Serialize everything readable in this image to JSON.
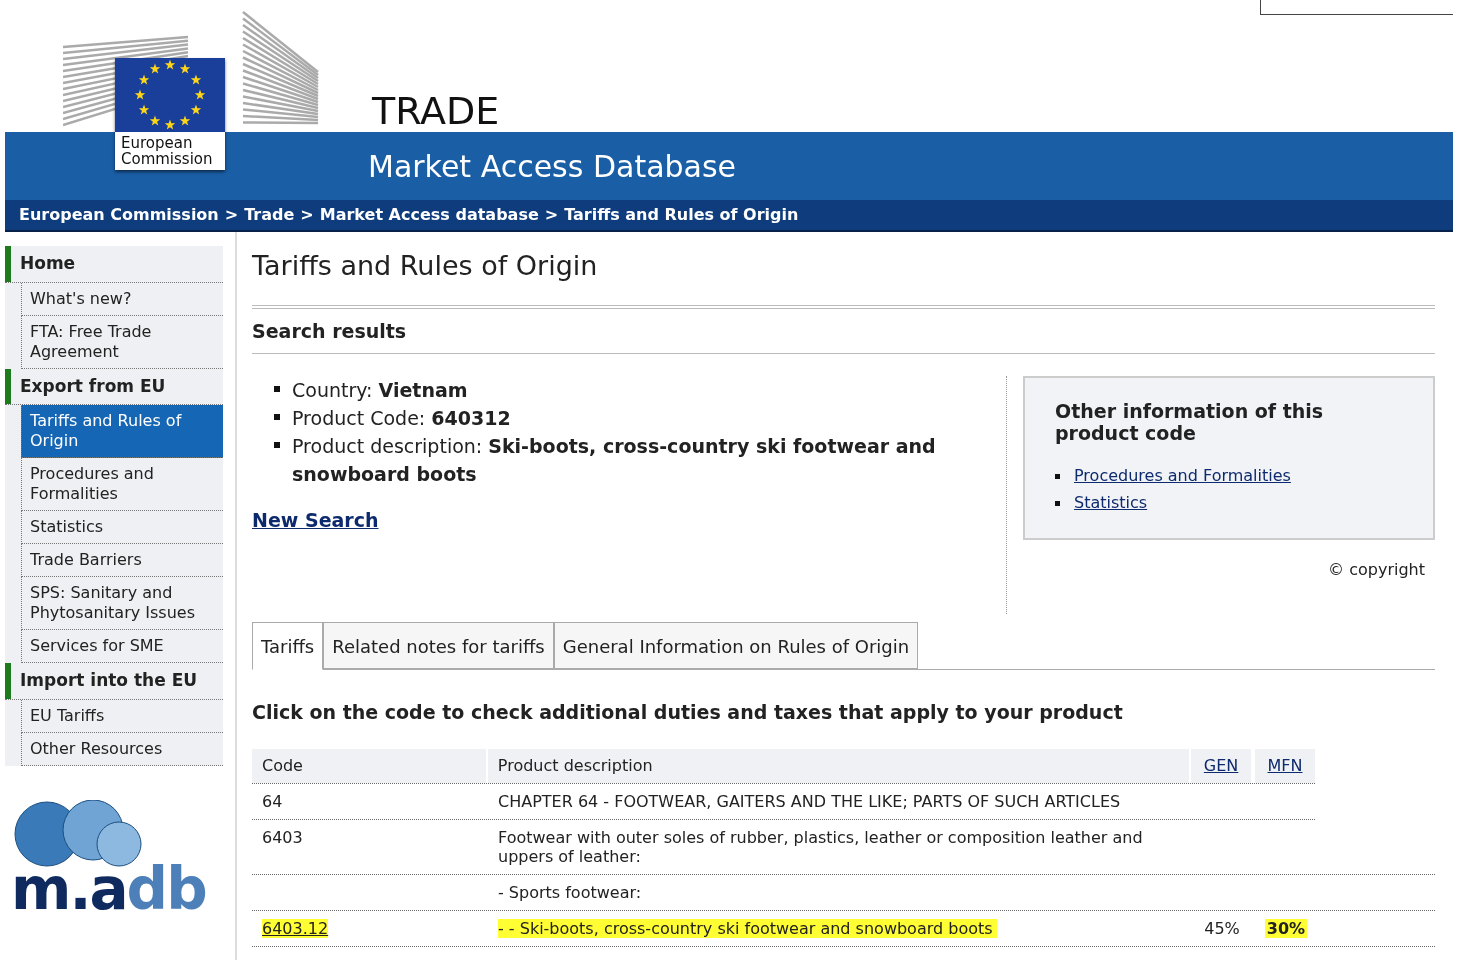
{
  "header": {
    "logo_caption": "European Commission",
    "madb_logo": [
      "m.a",
      "db"
    ],
    "site_section": "TRADE",
    "site_title": "Market Access Database"
  },
  "breadcrumb": [
    "European Commission",
    "Trade",
    "Market Access database",
    "Tariffs and Rules of Origin"
  ],
  "breadcrumb_separator": ">",
  "sidebar": {
    "sections": [
      {
        "label": "Home",
        "children": [
          {
            "label": "What's new?",
            "selected": false
          },
          {
            "label": "FTA: Free Trade Agreement",
            "selected": false
          }
        ]
      },
      {
        "label": "Export from EU",
        "children": [
          {
            "label": "Tariffs and Rules of Origin",
            "selected": true
          },
          {
            "label": "Procedures and Formalities",
            "selected": false
          },
          {
            "label": "Statistics",
            "selected": false
          },
          {
            "label": "Trade Barriers",
            "selected": false
          },
          {
            "label": "SPS: Sanitary and Phytosanitary Issues",
            "selected": false
          },
          {
            "label": "Services for SME",
            "selected": false
          }
        ]
      },
      {
        "label": "Import into the EU",
        "children": [
          {
            "label": "EU Tariffs",
            "selected": false
          },
          {
            "label": "Other Resources",
            "selected": false
          }
        ]
      }
    ]
  },
  "page_title": "Tariffs and Rules of Origin",
  "search_results": {
    "heading": "Search results",
    "criteria": [
      {
        "label": "Country:",
        "value": "Vietnam"
      },
      {
        "label": "Product Code:",
        "value": "640312"
      },
      {
        "label": "Product description:",
        "value": "Ski-boots, cross-country ski footwear and snowboard boots"
      }
    ],
    "new_search": "New Search"
  },
  "other_info": {
    "heading": "Other information of this product code",
    "links": [
      "Procedures and Formalities",
      "Statistics"
    ]
  },
  "copyright": "© copyright",
  "tabs": [
    {
      "label": "Tariffs",
      "selected": true
    },
    {
      "label": "Related notes for tariffs",
      "selected": false
    },
    {
      "label": "General Information on Rules of Origin",
      "selected": false
    }
  ],
  "instruction": "Click on the code to check additional duties and taxes that apply to your product",
  "table": {
    "columns": [
      "Code",
      "Product description",
      "GEN",
      "MFN"
    ],
    "rows": [
      {
        "code": "64",
        "description": "CHAPTER 64 - FOOTWEAR, GAITERS AND THE LIKE; PARTS OF SUCH ARTICLES",
        "highlighted": false
      },
      {
        "code": "6403",
        "description": "Footwear with outer soles of rubber, plastics, leather or composition leather and uppers of leather:",
        "highlighted": false
      },
      {
        "description": "- Sports footwear:",
        "highlighted": false
      },
      {
        "code": "6403.12",
        "description": "- - Ski-boots, cross-country ski footwear and snowboard boots",
        "gen": "45%",
        "mfn": "30%",
        "highlighted": true
      }
    ]
  }
}
